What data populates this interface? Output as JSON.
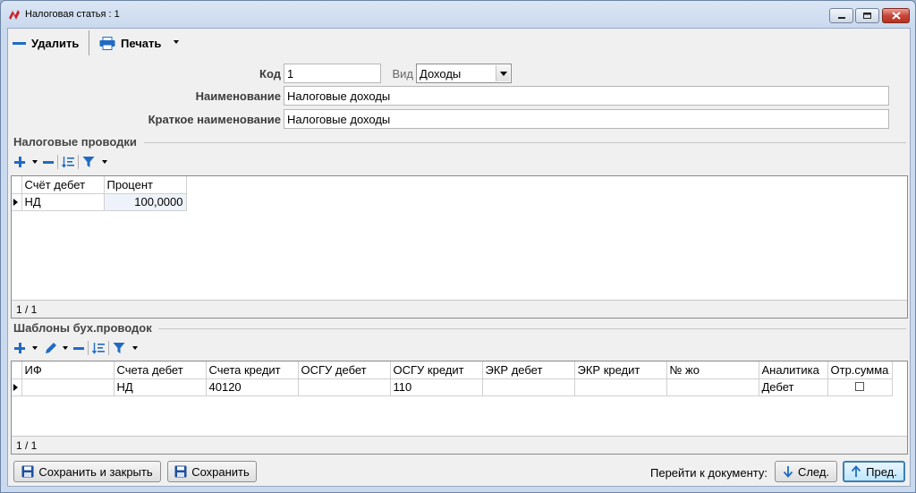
{
  "window": {
    "title": "Налоговая статья : 1"
  },
  "toolbar": {
    "delete_label": "Удалить",
    "print_label": "Печать"
  },
  "form": {
    "code_label": "Код",
    "code_value": "1",
    "type_label": "Вид",
    "type_value": "Доходы",
    "name_label": "Наименование",
    "name_value": "Налоговые доходы",
    "short_name_label": "Краткое наименование",
    "short_name_value": "Налоговые доходы"
  },
  "tax_entries": {
    "title": "Налоговые проводки",
    "columns": [
      "Счёт дебет",
      "Процент"
    ],
    "rows": [
      {
        "debit_account": "НД",
        "percent": "100,0000"
      }
    ],
    "footer": "1 / 1"
  },
  "templates": {
    "title": "Шаблоны бух.проводок",
    "columns": [
      "ИФ",
      "Счета дебет",
      "Счета кредит",
      "ОСГУ дебет",
      "ОСГУ кредит",
      "ЭКР дебет",
      "ЭКР кредит",
      "№ жо",
      "Аналитика",
      "Отр.сумма"
    ],
    "rows": [
      {
        "if": "",
        "debit": "НД",
        "credit": "40120",
        "osgu_debit": "",
        "osgu_credit": "110",
        "ekr_debit": "",
        "ekr_credit": "",
        "jo": "",
        "analytics": "Дебет",
        "neg_sum": false
      }
    ],
    "footer": "1 / 1"
  },
  "bottom": {
    "save_close_label": "Сохранить и закрыть",
    "save_label": "Сохранить",
    "goto_label": "Перейти к документу:",
    "next_label": "След.",
    "prev_label": "Пред."
  },
  "colors": {
    "accent": "#1f6bc4",
    "default_button_border": "#3c7fb1"
  }
}
